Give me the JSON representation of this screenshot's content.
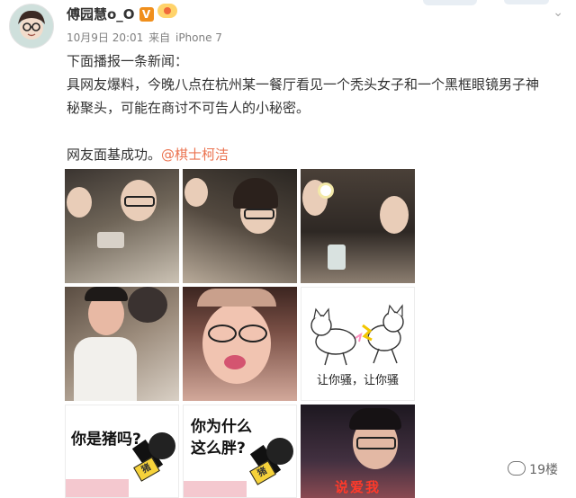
{
  "post": {
    "author": "傅园慧o_O",
    "timestamp": "10月9日 20:01",
    "source_prefix": "来自",
    "source": "iPhone 7",
    "text_line1": "下面播报一条新闻：",
    "text_line2": "具网友爆料，今晚八点在杭州某一餐厅看见一个秃头女子和一个黑框眼镜男子神",
    "text_line3": "秘聚头，可能在商讨不可告人的小秘密。",
    "text_line4_prefix": "网友面基成功。",
    "mention": "@棋士柯洁"
  },
  "images": {
    "meme6_caption": "让你骚，让你骚",
    "meme7_text": "你是猪吗?",
    "meme8_line1": "你为什么",
    "meme8_line2": "这么胖?",
    "mic_label": "猪",
    "photo9_text": "说爱我"
  },
  "watermark": {
    "text": "19楼"
  },
  "colors": {
    "mention": "#eb7350",
    "meta": "#808080",
    "verified_badge": "#f08f1c"
  }
}
